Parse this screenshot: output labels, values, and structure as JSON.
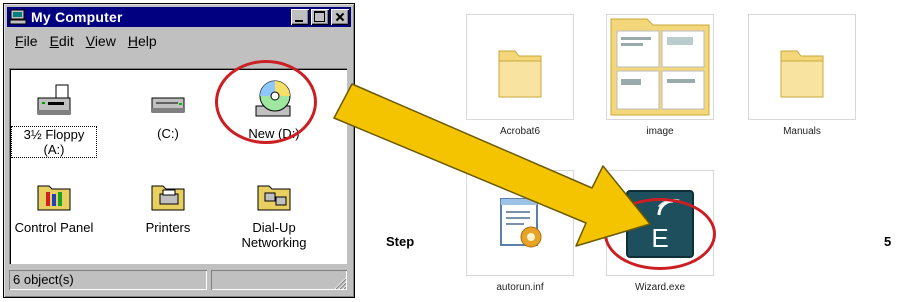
{
  "window": {
    "title": "My Computer",
    "menu": [
      {
        "underline": "F",
        "rest": "ile"
      },
      {
        "underline": "E",
        "rest": "dit"
      },
      {
        "underline": "V",
        "rest": "iew"
      },
      {
        "underline": "H",
        "rest": "elp"
      }
    ],
    "drives": [
      {
        "label": "3½ Floppy (A:)",
        "icon": "floppy-drive-icon"
      },
      {
        "label": "(C:)",
        "icon": "hard-drive-icon"
      },
      {
        "label": "New (D:)",
        "icon": "cd-drive-icon"
      },
      {
        "label": "Control Panel",
        "icon": "control-panel-icon"
      },
      {
        "label": "Printers",
        "icon": "printers-icon"
      },
      {
        "label": "Dial-Up Networking",
        "icon": "dial-up-networking-icon"
      }
    ],
    "status": "6 object(s)"
  },
  "files": [
    {
      "label": "Acrobat6",
      "icon": "folder-icon"
    },
    {
      "label": "image",
      "icon": "image-folder-icon"
    },
    {
      "label": "Manuals",
      "icon": "folder-icon"
    },
    {
      "label": "autorun.inf",
      "icon": "autorun-file-icon"
    },
    {
      "label": "Wizard.exe",
      "icon": "wizard-app-icon"
    }
  ],
  "step": {
    "label": "Step",
    "number": "5"
  },
  "colors": {
    "titlebar": "#000080",
    "highlight_circle": "#cc1f24",
    "arrow_fill": "#f5c400",
    "arrow_stroke": "#6b5a00",
    "folder_yellow": "#f3d77a"
  }
}
